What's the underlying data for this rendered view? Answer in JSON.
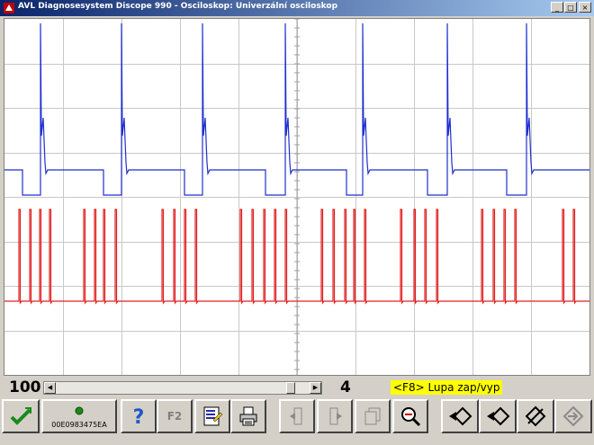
{
  "window": {
    "title": "AVL Diagnosesystem Discope 990 - Osciloskop: Univerzální osciloskop",
    "min_glyph": "_",
    "max_glyph": "□",
    "close_glyph": "×"
  },
  "scope": {
    "grid_color": "#c8c8c8",
    "channel1_color": "#1f2fcf",
    "channel2_color": "#e02020"
  },
  "status": {
    "scale_value": "100",
    "page_value": "4",
    "hint": "<F8> Lupa zap/vyp",
    "scroll_position": 0.94
  },
  "toolbar": {
    "ok_icon": "check-icon",
    "device_id": "00E0983475EA",
    "help_glyph": "?",
    "f2_label": "F2"
  }
}
